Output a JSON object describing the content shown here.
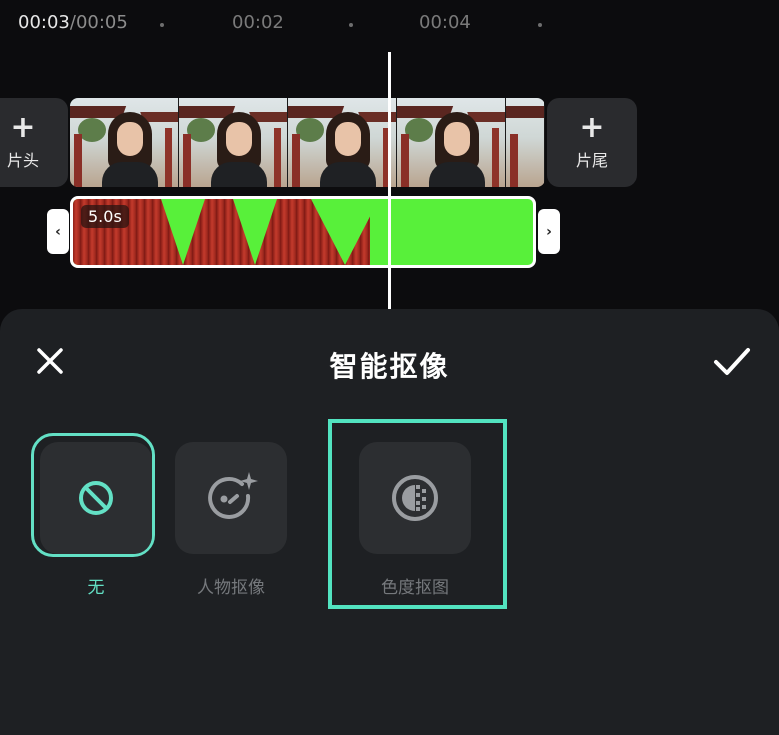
{
  "timeline": {
    "current_time": "00:03",
    "total_time": "/00:05",
    "ticks": [
      "00:02",
      "00:04"
    ],
    "add_head_label": "片头",
    "add_tail_label": "片尾",
    "overlay_duration": "5.0s"
  },
  "panel": {
    "title": "智能抠像",
    "options": [
      {
        "label": "无",
        "icon": "none-icon",
        "selected": true
      },
      {
        "label": "人物抠像",
        "icon": "portrait-cutout-icon",
        "selected": false
      },
      {
        "label": "色度抠图",
        "icon": "chroma-key-icon",
        "selected": false
      }
    ]
  },
  "colors": {
    "accent": "#63e0c5",
    "highlight": "#52e3c0",
    "green_screen": "#58f03a"
  }
}
